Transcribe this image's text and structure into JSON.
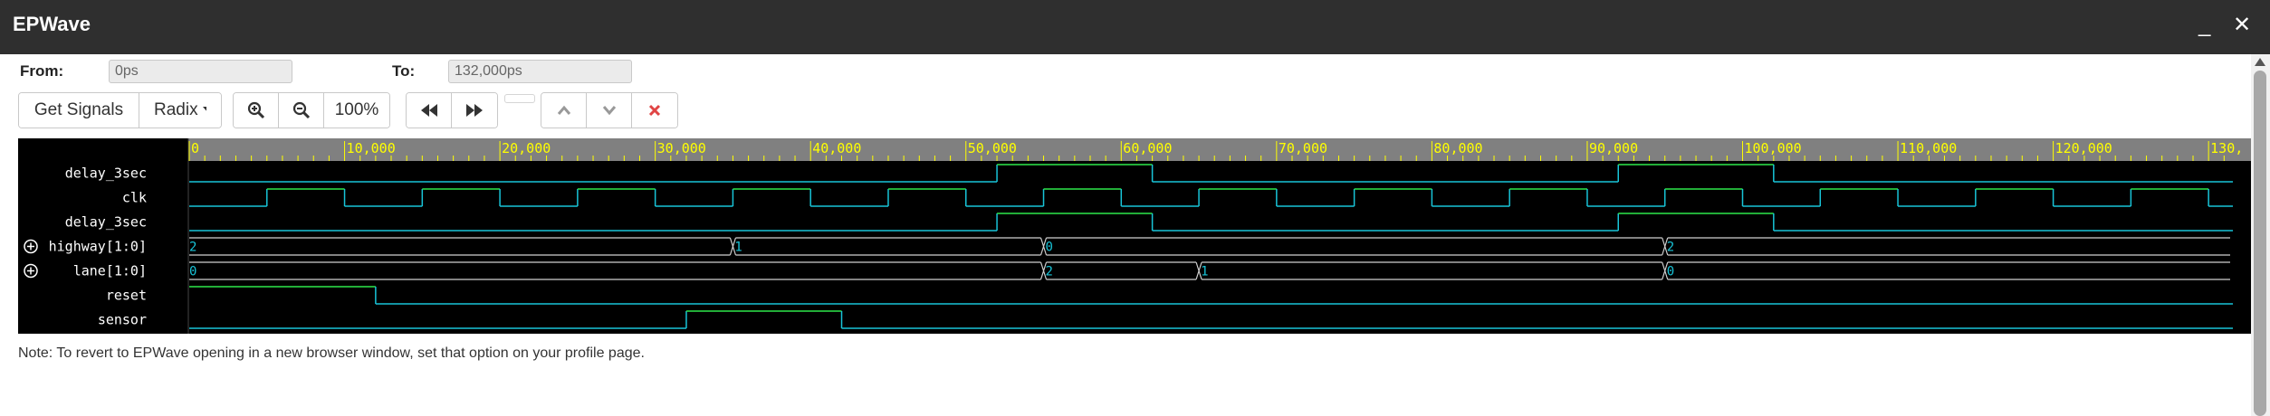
{
  "window": {
    "title": "EPWave",
    "minimize": "_",
    "close": "✕"
  },
  "range": {
    "from_label": "From:",
    "from_value": "0ps",
    "to_label": "To:",
    "to_value": "132,000ps"
  },
  "toolbar": {
    "get_signals": "Get Signals",
    "radix": "Radix",
    "zoom_level": "100%",
    "buttons": [
      "zoom-in-icon",
      "zoom-out-icon",
      "rewind-icon",
      "fast-forward-icon",
      "caret-up-icon",
      "caret-down-icon",
      "delete-icon"
    ]
  },
  "timeline": {
    "time_unit": "ps",
    "max_time": 132000,
    "ticks": [
      {
        "t": 0,
        "label": "0"
      },
      {
        "t": 10000,
        "label": "10,000"
      },
      {
        "t": 20000,
        "label": "20,000"
      },
      {
        "t": 30000,
        "label": "30,000"
      },
      {
        "t": 40000,
        "label": "40,000"
      },
      {
        "t": 50000,
        "label": "50,000"
      },
      {
        "t": 60000,
        "label": "60,000"
      },
      {
        "t": 70000,
        "label": "70,000"
      },
      {
        "t": 80000,
        "label": "80,000"
      },
      {
        "t": 90000,
        "label": "90,000"
      },
      {
        "t": 100000,
        "label": "100,000"
      },
      {
        "t": 110000,
        "label": "110,000"
      },
      {
        "t": 120000,
        "label": "120,000"
      },
      {
        "t": 130000,
        "label": "130,"
      }
    ]
  },
  "signals": [
    {
      "name": "delay_3sec",
      "type": "bit",
      "expandable": false,
      "changes": [
        [
          0,
          0
        ],
        [
          52000,
          1
        ],
        [
          62000,
          0
        ],
        [
          92000,
          1
        ],
        [
          102000,
          0
        ]
      ]
    },
    {
      "name": "clk",
      "type": "bit",
      "expandable": false,
      "changes": [
        [
          0,
          0
        ],
        [
          5000,
          1
        ],
        [
          10000,
          0
        ],
        [
          15000,
          1
        ],
        [
          20000,
          0
        ],
        [
          25000,
          1
        ],
        [
          30000,
          0
        ],
        [
          35000,
          1
        ],
        [
          40000,
          0
        ],
        [
          45000,
          1
        ],
        [
          50000,
          0
        ],
        [
          55000,
          1
        ],
        [
          60000,
          0
        ],
        [
          65000,
          1
        ],
        [
          70000,
          0
        ],
        [
          75000,
          1
        ],
        [
          80000,
          0
        ],
        [
          85000,
          1
        ],
        [
          90000,
          0
        ],
        [
          95000,
          1
        ],
        [
          100000,
          0
        ],
        [
          105000,
          1
        ],
        [
          110000,
          0
        ],
        [
          115000,
          1
        ],
        [
          120000,
          0
        ],
        [
          125000,
          1
        ],
        [
          130000,
          0
        ]
      ]
    },
    {
      "name": "delay_3sec",
      "type": "bit",
      "expandable": false,
      "changes": [
        [
          0,
          0
        ],
        [
          52000,
          1
        ],
        [
          62000,
          0
        ],
        [
          92000,
          1
        ],
        [
          102000,
          0
        ]
      ]
    },
    {
      "name": "highway[1:0]",
      "type": "bus",
      "expandable": true,
      "changes": [
        [
          0,
          "2"
        ],
        [
          35000,
          "1"
        ],
        [
          55000,
          "0"
        ],
        [
          95000,
          "2"
        ]
      ]
    },
    {
      "name": "lane[1:0]",
      "type": "bus",
      "expandable": true,
      "changes": [
        [
          0,
          "0"
        ],
        [
          55000,
          "2"
        ],
        [
          65000,
          "1"
        ],
        [
          95000,
          "0"
        ]
      ]
    },
    {
      "name": "reset",
      "type": "bit",
      "expandable": false,
      "changes": [
        [
          0,
          1
        ],
        [
          12000,
          0
        ]
      ]
    },
    {
      "name": "sensor",
      "type": "bit",
      "expandable": false,
      "changes": [
        [
          0,
          0
        ],
        [
          32000,
          1
        ],
        [
          42000,
          0
        ]
      ]
    }
  ],
  "note": "Note: To revert to EPWave opening in a new browser window, set that option on your profile page.",
  "colors": {
    "wave": "#18c4d8",
    "wave_high": "#2ee84a",
    "ruler_bg": "#808080",
    "ruler_text": "#ffff00",
    "canvas_bg": "#000000",
    "bus_line": "#cfcfcf",
    "delete": "#e04444"
  }
}
